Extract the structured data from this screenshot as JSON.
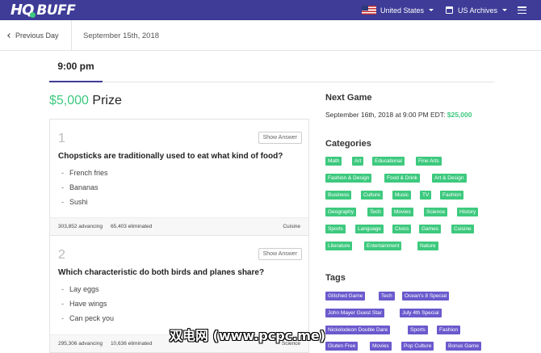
{
  "nav": {
    "logo_hq": "HQ",
    "logo_buff": "BUFF",
    "country": "United States",
    "archives": "US Archives"
  },
  "subnav": {
    "prev_day": "Previous Day",
    "date": "September 15th, 2018"
  },
  "tab": {
    "time": "9:00 pm"
  },
  "prize": {
    "amount": "$5,000",
    "label": "Prize"
  },
  "questions": [
    {
      "number": "1",
      "show_answer": "Show Answer",
      "text": "Chopsticks are traditionally used to eat what kind of food?",
      "answers": [
        "French fries",
        "Bananas",
        "Sushi"
      ],
      "advancing": "303,852 advancing",
      "eliminated": "65,403 eliminated",
      "category": "Cuisine"
    },
    {
      "number": "2",
      "show_answer": "Show Answer",
      "text": "Which characteristic do both birds and planes share?",
      "answers": [
        "Lay eggs",
        "Have wings",
        "Can peck you"
      ],
      "advancing": "295,306 advancing",
      "eliminated": "10,636 eliminated",
      "category": "Science"
    }
  ],
  "next_game": {
    "title": "Next Game",
    "text": "September 16th, 2018 at 9:00 PM EDT: ",
    "amount": "$25,000"
  },
  "categories": {
    "title": "Categories",
    "items": [
      "Math",
      "Art",
      "Educational",
      "Fine Arts",
      "Fashion & Design",
      "Food & Drink",
      "Art & Design",
      "Business",
      "Culture",
      "Music",
      "TV",
      "Fashion",
      "Geography",
      "Tech",
      "Movies",
      "Science",
      "History",
      "Sports",
      "Language",
      "Civics",
      "Games",
      "Cuisine",
      "Literature",
      "Entertainment",
      "Nature"
    ]
  },
  "tags": {
    "title": "Tags",
    "items": [
      "Glitched Game",
      "Tech",
      "Ocean's 8 Special",
      "John Mayer Guest Star",
      "July 4th Special",
      "Nickelodeon Double Dare",
      "Sports",
      "Fashion",
      "Gluten Free",
      "Movies",
      "Pop Culture",
      "Bonus Game"
    ]
  },
  "watermark": "双电网 (www.pcpc.me)",
  "colors": {
    "nav_bg": "#3e3c97",
    "accent_green": "#3dc97e",
    "tag_purple": "#6a5acd"
  }
}
